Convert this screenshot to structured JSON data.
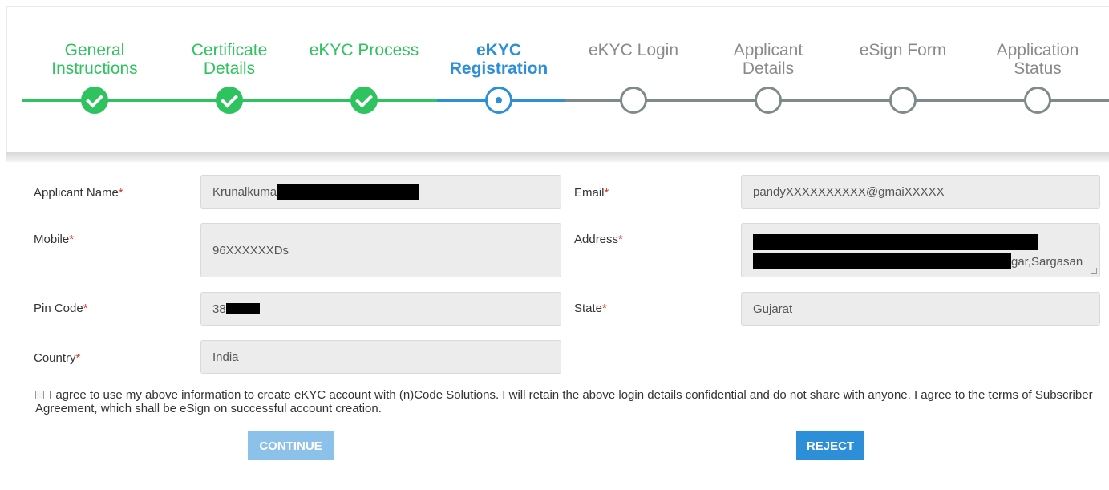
{
  "steps": [
    {
      "label_line1": "General",
      "label_line2": "Instructions",
      "state": "done"
    },
    {
      "label_line1": "Certificate",
      "label_line2": "Details",
      "state": "done"
    },
    {
      "label_line1": "eKYC Process",
      "label_line2": "",
      "state": "done"
    },
    {
      "label_line1": "eKYC",
      "label_line2": "Registration",
      "state": "active"
    },
    {
      "label_line1": "eKYC Login",
      "label_line2": "",
      "state": "todo"
    },
    {
      "label_line1": "Applicant",
      "label_line2": "Details",
      "state": "todo"
    },
    {
      "label_line1": "eSign Form",
      "label_line2": "",
      "state": "todo"
    },
    {
      "label_line1": "Application",
      "label_line2": "Status",
      "state": "todo"
    }
  ],
  "form": {
    "applicant_name": {
      "label": "Applicant Name",
      "value": "Krunalkuma"
    },
    "email": {
      "label": "Email",
      "value": "pandyXXXXXXXXXX@gmaiXXXXX"
    },
    "mobile": {
      "label": "Mobile",
      "value": "96XXXXXXDs"
    },
    "address": {
      "label": "Address",
      "value_tail": "gar,Sargasan"
    },
    "pin_code": {
      "label": "Pin Code",
      "value": "38"
    },
    "state": {
      "label": "State",
      "value": "Gujarat"
    },
    "country": {
      "label": "Country",
      "value": "India"
    },
    "required_mark": "*"
  },
  "agreement": {
    "text": "I agree to use my above information to create eKYC account with (n)Code Solutions. I will retain the above login details confidential and do not share with anyone. I agree to the terms of Subscriber Agreement, which shall be eSign on successful account creation."
  },
  "buttons": {
    "continue": "CONTINUE",
    "reject": "REJECT"
  },
  "colors": {
    "done": "#2ec35f",
    "active": "#2d8fd8",
    "todo": "#7f8a8a",
    "button_primary": "#2d8fd8",
    "button_disabled": "#8cc1ea",
    "required": "#d9342b"
  }
}
